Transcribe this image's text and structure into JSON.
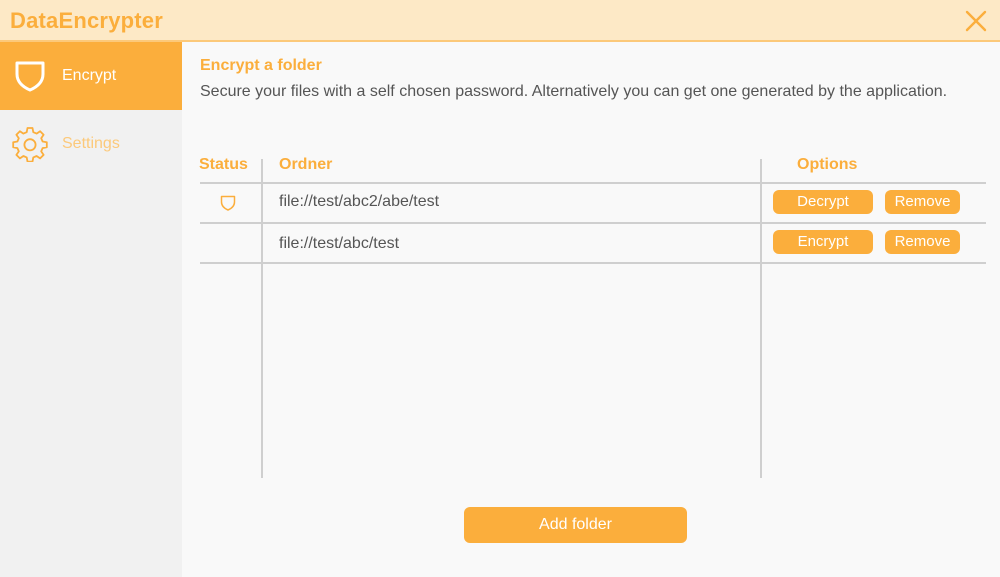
{
  "app": {
    "title": "DataEncrypter"
  },
  "colors": {
    "accent": "#fbae3c",
    "titlebar_bg": "#fde9c6",
    "sidebar_bg": "#f1f1f1",
    "content_bg": "#f9f9f9",
    "text": "#555555"
  },
  "titlebar": {
    "close_icon": "close-icon"
  },
  "sidebar": {
    "items": [
      {
        "label": "Encrypt",
        "icon": "shield-icon",
        "active": true
      },
      {
        "label": "Settings",
        "icon": "gear-icon",
        "active": false
      }
    ]
  },
  "main": {
    "title": "Encrypt a folder",
    "description": "Secure your files with a self chosen password. Alternatively you can get one generated by the application.",
    "table": {
      "columns": {
        "status": "Status",
        "folder": "Ordner",
        "options": "Options"
      },
      "rows": [
        {
          "status_icon": "shield-icon",
          "path": "file://test/abc2/abe/test",
          "action_label": "Decrypt",
          "remove_label": "Remove"
        },
        {
          "status_icon": "",
          "path": "file://test/abc/test",
          "action_label": "Encrypt",
          "remove_label": "Remove"
        }
      ]
    },
    "add_button_label": "Add folder"
  }
}
